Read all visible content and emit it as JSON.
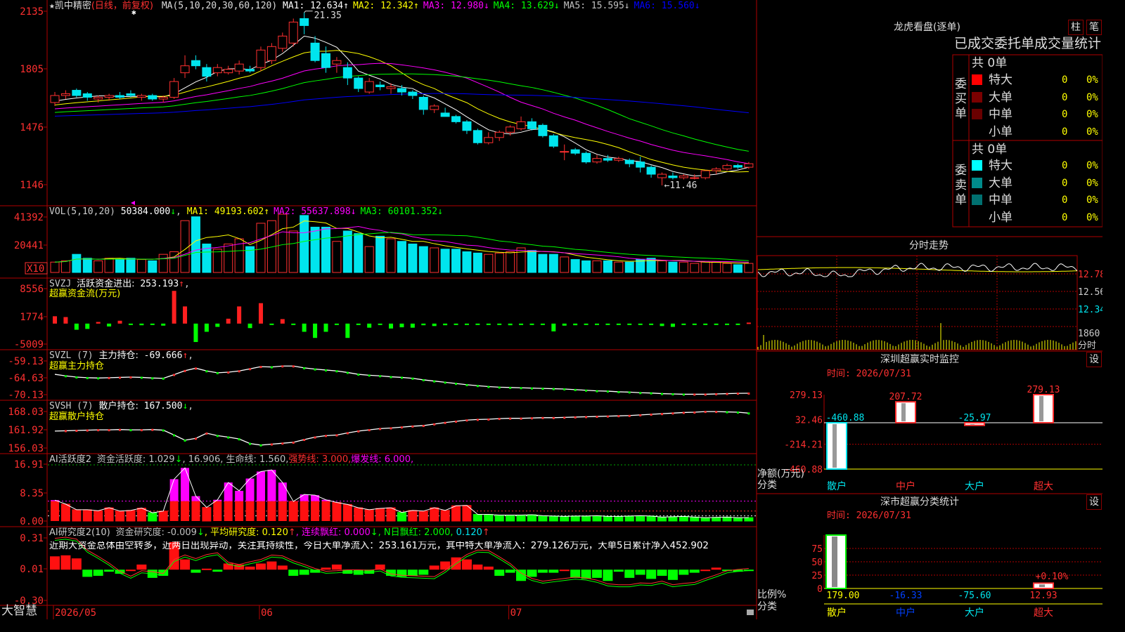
{
  "stock": {
    "name_prefix": "★",
    "name": "凯中精密",
    "period": "(日线，前复权)",
    "star_marker": "✱",
    "logo": "大智慧"
  },
  "colors": {
    "up": "#ff3030",
    "down": "#00e5ee",
    "bg": "#000000",
    "grid": "#8b0000",
    "text": "#c0c0c0",
    "ma1": "#ffffff",
    "ma2": "#ffff00",
    "ma3": "#ff00ff",
    "ma4": "#00ff00",
    "ma5": "#c0c0c0",
    "ma6": "#0000ff",
    "green": "#00ff00",
    "yellow": "#ffff00",
    "magenta": "#ff00ff",
    "cyan": "#00ffff"
  },
  "x_axis": {
    "labels": [
      {
        "text": "2026/05",
        "i": 0
      },
      {
        "text": "06",
        "i": 19
      },
      {
        "text": "07",
        "i": 42
      }
    ]
  },
  "price_panel": {
    "label": "MA(5,10,20,30,60,120)",
    "ma": [
      {
        "name": "MA1:",
        "value": "12.634",
        "arrow": "↑",
        "color": "#ffffff"
      },
      {
        "name": "MA2:",
        "value": "12.342",
        "arrow": "↑",
        "color": "#ffff00"
      },
      {
        "name": "MA3:",
        "value": "12.980",
        "arrow": "↓",
        "color": "#ff00ff"
      },
      {
        "name": "MA4:",
        "value": "13.629",
        "arrow": "↓",
        "color": "#00ff00"
      },
      {
        "name": "MA5:",
        "value": "15.595",
        "arrow": "↓",
        "color": "#c0c0c0"
      },
      {
        "name": "MA6:",
        "value": "15.560",
        "arrow": "↓",
        "color": "#0000ff"
      }
    ],
    "y_labels": [
      "2135",
      "1805",
      "1476",
      "1146"
    ],
    "high_label": "21.35",
    "low_label": "←11.46"
  },
  "vol_panel": {
    "label": "VOL(5,10,20)",
    "value": "50384.000",
    "arrow": "↓",
    "ma": [
      {
        "name": "MA1:",
        "value": "49193.602",
        "arrow": "↑",
        "color": "#ffff00"
      },
      {
        "name": "MA2:",
        "value": "55637.898",
        "arrow": "↓",
        "color": "#ff00ff"
      },
      {
        "name": "MA3:",
        "value": "60101.352",
        "arrow": "↓",
        "color": "#00ff00"
      }
    ],
    "y_labels": [
      "41392",
      "20441"
    ],
    "unit": "X10"
  },
  "svzj_panel": {
    "label": "SVZJ",
    "name": "活跃资金进出:",
    "value": "253.193",
    "arrow": "↑",
    "subtitle": "超赢资金流(万元)",
    "y_labels": [
      "8556",
      "1774",
      "-5009"
    ]
  },
  "svzl_panel": {
    "label": "SVZL (7)",
    "name": "主力持仓:",
    "value": "-69.666",
    "arrow": "↑",
    "subtitle": "超赢主力持仓",
    "y_labels": [
      "-59.13",
      "-64.63",
      "-70.13"
    ]
  },
  "svsh_panel": {
    "label": "SVSH (7)",
    "name": "散户持仓:",
    "value": "167.500",
    "arrow": "↓",
    "subtitle": "超赢散户持仓",
    "y_labels": [
      "168.03",
      "161.92",
      "156.03"
    ]
  },
  "ai1_panel": {
    "label": "AI活跃度2",
    "items": [
      {
        "text": "资金活跃度: 1.029",
        "color": "#c0c0c0"
      },
      {
        "text": "↓",
        "color": "#00ff00"
      },
      {
        "text": ", 16.906, 生命线: 1.560,",
        "color": "#c0c0c0"
      },
      {
        "text": "强势线: 3.000,",
        "color": "#ff3030"
      },
      {
        "text": "爆发线: 6.000,",
        "color": "#ff00ff"
      }
    ],
    "y_labels": [
      "16.91",
      "8.35",
      "0.00"
    ]
  },
  "ai2_panel": {
    "label": "AI研究度2(10)",
    "items": [
      {
        "text": "资金研究度: -0.009",
        "color": "#c0c0c0"
      },
      {
        "text": "↓",
        "color": "#00ff00"
      },
      {
        "text": ", 平均研究度: 0.120",
        "color": "#ffff00"
      },
      {
        "text": "↑",
        "color": "#ff3030"
      },
      {
        "text": ", 连续飘红: 0.000",
        "color": "#ff00ff"
      },
      {
        "text": "↓",
        "color": "#00ff00"
      },
      {
        "text": ", N日飘红: 2.000, ",
        "color": "#00ff00"
      },
      {
        "text": "0.120",
        "color": "#00e5ee"
      },
      {
        "text": "↑",
        "color": "#ff3030"
      }
    ],
    "comment": "近期大资金总体由空转多，近两日出现异动，关注其持续性，今日大单净流入：253.161万元，其中特大单净流入：279.126万元，大单5日累计净入452.902",
    "y_labels": [
      "0.31",
      "0.01",
      "-0.30"
    ]
  },
  "dragon_tiger": {
    "title": "龙虎看盘(逐单)",
    "btn1": "柱",
    "btn2": "笔",
    "header": "已成交委托单成交量统计",
    "buy": {
      "side": "委买单",
      "total": "共 0单",
      "rows": [
        {
          "label": "特大",
          "count": "0",
          "pct": "0%",
          "color": "#ff0000"
        },
        {
          "label": "大单",
          "count": "0",
          "pct": "0%",
          "color": "#7a0000"
        },
        {
          "label": "中单",
          "count": "0",
          "pct": "0%",
          "color": "#6a0000"
        },
        {
          "label": "小单",
          "count": "0",
          "pct": "0%",
          "color": "#000000"
        }
      ]
    },
    "sell": {
      "side": "委卖单",
      "total": "共 0单",
      "rows": [
        {
          "label": "特大",
          "count": "0",
          "pct": "0%",
          "color": "#00ffff"
        },
        {
          "label": "大单",
          "count": "0",
          "pct": "0%",
          "color": "#008b8b"
        },
        {
          "label": "中单",
          "count": "0",
          "pct": "0%",
          "color": "#007070"
        },
        {
          "label": "小单",
          "count": "0",
          "pct": "0%",
          "color": "#000000"
        }
      ]
    }
  },
  "intraday": {
    "title": "分时走势",
    "y_labels": [
      "12.78",
      "12.56",
      "12.34"
    ],
    "vol_label": "1860",
    "vol_unit": "分时"
  },
  "monitor": {
    "title": "深圳超赢实时监控",
    "btn": "设",
    "date": "时间: 2026/07/31",
    "y_labels": [
      "279.13",
      "32.46",
      "-214.21",
      "-460.88"
    ],
    "axis_title": "净额(万元)",
    "axis_sub": "分类",
    "categories": [
      "散户",
      "中户",
      "大户",
      "超大"
    ],
    "values": [
      -460.88,
      207.72,
      -25.97,
      279.13
    ],
    "value_labels": [
      "-460.88",
      "207.72",
      "-25.97",
      "279.13"
    ]
  },
  "classify": {
    "title": "深市超赢分类统计",
    "btn": "设",
    "date": "时间: 2026/07/31",
    "y_labels": [
      "75",
      "50",
      "25",
      "0"
    ],
    "axis_title": "比例%",
    "axis_sub": "分类",
    "categories": [
      "散户",
      "中户",
      "大户",
      "超大"
    ],
    "values": [
      179.0,
      -16.33,
      -75.6,
      12.93
    ],
    "value_labels": [
      "179.00",
      "-16.33",
      "-75.60",
      "12.93"
    ],
    "extra_label": "+0.10%"
  },
  "chart_data": [
    {
      "type": "candlestick",
      "title": "凯中精密 (日线，前复权)",
      "ylim": [
        11.3,
        21.5
      ],
      "ohlc": [
        [
          16.2,
          16.8,
          16.0,
          16.6
        ],
        [
          16.6,
          16.9,
          16.4,
          16.7
        ],
        [
          16.9,
          17.0,
          16.5,
          16.6
        ],
        [
          16.7,
          16.8,
          16.3,
          16.5
        ],
        [
          16.4,
          16.6,
          16.2,
          16.5
        ],
        [
          16.5,
          16.7,
          16.3,
          16.6
        ],
        [
          16.6,
          16.8,
          16.4,
          16.5
        ],
        [
          16.7,
          16.9,
          16.5,
          16.6
        ],
        [
          16.5,
          16.7,
          16.3,
          16.6
        ],
        [
          16.6,
          16.7,
          16.3,
          16.4
        ],
        [
          16.4,
          16.6,
          16.2,
          16.5
        ],
        [
          16.5,
          17.6,
          16.4,
          17.4
        ],
        [
          17.9,
          18.9,
          17.6,
          18.3
        ],
        [
          18.6,
          18.9,
          18.1,
          18.3
        ],
        [
          18.2,
          18.4,
          17.4,
          17.7
        ],
        [
          17.9,
          18.4,
          17.7,
          18.2
        ],
        [
          17.9,
          18.3,
          17.8,
          18.1
        ],
        [
          18.0,
          18.6,
          17.8,
          18.4
        ],
        [
          18.1,
          18.3,
          17.9,
          18.0
        ],
        [
          18.2,
          19.4,
          18.0,
          19.2
        ],
        [
          18.6,
          19.6,
          18.4,
          19.4
        ],
        [
          19.3,
          20.2,
          19.1,
          20.0
        ],
        [
          19.6,
          21.0,
          19.4,
          20.8
        ],
        [
          21.0,
          21.35,
          20.1,
          20.6
        ],
        [
          19.6,
          20.0,
          18.5,
          18.6
        ],
        [
          19.0,
          19.4,
          17.9,
          18.2
        ],
        [
          18.4,
          18.8,
          17.9,
          18.6
        ],
        [
          18.2,
          18.5,
          17.2,
          17.6
        ],
        [
          17.6,
          17.7,
          16.8,
          17.0
        ],
        [
          16.8,
          17.6,
          16.7,
          17.4
        ],
        [
          17.2,
          17.4,
          16.9,
          17.1
        ],
        [
          17.0,
          17.3,
          16.7,
          17.1
        ],
        [
          17.0,
          17.2,
          16.6,
          16.8
        ],
        [
          16.8,
          16.9,
          16.4,
          16.6
        ],
        [
          16.5,
          16.6,
          15.5,
          15.8
        ],
        [
          15.8,
          16.1,
          15.6,
          16.0
        ],
        [
          15.6,
          15.9,
          15.4,
          15.4
        ],
        [
          15.4,
          15.5,
          15.0,
          15.1
        ],
        [
          15.1,
          15.2,
          14.4,
          14.6
        ],
        [
          14.6,
          14.7,
          13.8,
          13.9
        ],
        [
          13.9,
          14.5,
          13.8,
          14.2
        ],
        [
          14.2,
          14.6,
          14.0,
          14.5
        ],
        [
          14.5,
          14.9,
          14.3,
          14.8
        ],
        [
          14.7,
          15.4,
          14.6,
          15.1
        ],
        [
          15.1,
          15.3,
          14.6,
          14.7
        ],
        [
          14.9,
          15.0,
          14.2,
          14.3
        ],
        [
          14.3,
          14.4,
          13.6,
          13.7
        ],
        [
          13.4,
          13.8,
          12.9,
          13.4
        ],
        [
          13.5,
          13.6,
          13.2,
          13.3
        ],
        [
          13.3,
          13.4,
          12.7,
          12.8
        ],
        [
          12.8,
          13.2,
          12.7,
          13.0
        ],
        [
          13.0,
          13.2,
          12.8,
          12.9
        ],
        [
          12.9,
          13.1,
          12.8,
          13.0
        ],
        [
          12.9,
          13.0,
          12.5,
          12.7
        ],
        [
          12.8,
          13.1,
          12.2,
          12.5
        ],
        [
          12.5,
          12.6,
          11.9,
          12.1
        ],
        [
          11.9,
          12.2,
          11.46,
          12.1
        ],
        [
          12.0,
          12.2,
          11.8,
          11.9
        ],
        [
          11.9,
          12.1,
          11.8,
          12.0
        ],
        [
          11.9,
          12.1,
          11.8,
          11.9
        ],
        [
          11.9,
          12.3,
          11.8,
          12.3
        ],
        [
          12.3,
          12.5,
          12.1,
          12.4
        ],
        [
          12.4,
          12.7,
          12.3,
          12.6
        ],
        [
          12.6,
          12.7,
          12.4,
          12.5
        ],
        [
          12.5,
          12.8,
          12.4,
          12.7
        ]
      ]
    },
    {
      "type": "bar",
      "title": "VOL(5,10,20)",
      "unit": "X10",
      "values": [
        8,
        9,
        14,
        11,
        9,
        11,
        10,
        11,
        10,
        9,
        14,
        16,
        40,
        43,
        22,
        18,
        22,
        26,
        20,
        38,
        40,
        45,
        32,
        44,
        35,
        35,
        24,
        32,
        30,
        20,
        28,
        26,
        24,
        22,
        20,
        19,
        18,
        18,
        16,
        15,
        14,
        15,
        16,
        19,
        17,
        14,
        14,
        12,
        10,
        9,
        9,
        9,
        8,
        8,
        10,
        11,
        9,
        8,
        8,
        7,
        8,
        8,
        7,
        6,
        7
      ]
    },
    {
      "type": "bar",
      "title": "SVZJ 活跃资金进出 (万元)",
      "ylim": [
        -5009,
        8556
      ],
      "values": [
        1800,
        1600,
        -1500,
        -1300,
        400,
        -700,
        700,
        -300,
        -400,
        -200,
        -500,
        8000,
        4200,
        -4500,
        -2000,
        -800,
        1200,
        4200,
        -1100,
        5000,
        -200,
        1100,
        -200,
        -2000,
        -3500,
        -2000,
        -200,
        -3500,
        -200,
        -1000,
        -300,
        -1200,
        -900,
        -1000,
        -400,
        -600,
        -400,
        -300,
        -300,
        -200,
        -300,
        -200,
        -400,
        -200,
        -300,
        -300,
        -1900,
        -500,
        -400,
        -300,
        -200,
        -200,
        -300,
        -200,
        -300,
        -200,
        -600,
        -800,
        -200,
        -200,
        -200,
        -200,
        -200,
        -200,
        253
      ]
    },
    {
      "type": "line",
      "title": "SVZL 主力持仓",
      "ylim": [
        -70.13,
        -59.13
      ],
      "values": [
        -63.5,
        -64.0,
        -64.4,
        -64.6,
        -64.7,
        -64.6,
        -64.5,
        -64.4,
        -64.5,
        -64.7,
        -64.8,
        -63.6,
        -62.3,
        -61.5,
        -62.4,
        -63.0,
        -62.8,
        -62.4,
        -61.7,
        -61.0,
        -61.1,
        -60.8,
        -60.8,
        -61.4,
        -61.8,
        -62.1,
        -62.4,
        -62.9,
        -63.5,
        -63.8,
        -64.0,
        -64.3,
        -64.5,
        -64.8,
        -65.3,
        -65.7,
        -66.1,
        -66.5,
        -66.9,
        -67.2,
        -67.5,
        -67.7,
        -67.8,
        -67.9,
        -68.0,
        -68.1,
        -68.2,
        -68.3,
        -68.5,
        -68.7,
        -68.9,
        -69.0,
        -69.2,
        -69.3,
        -69.5,
        -69.6,
        -69.8,
        -69.9,
        -70.0,
        -70.0,
        -70.0,
        -69.9,
        -69.8,
        -69.7,
        -69.666
      ]
    },
    {
      "type": "line",
      "title": "SVSH 散户持仓",
      "ylim": [
        156.03,
        168.03
      ],
      "values": [
        161.6,
        161.7,
        161.8,
        161.9,
        162.0,
        162.0,
        162.1,
        162.0,
        162.0,
        162.1,
        161.9,
        160.3,
        158.6,
        159.2,
        160.9,
        160.1,
        159.6,
        159.0,
        157.5,
        157.0,
        157.3,
        157.6,
        157.9,
        158.8,
        159.6,
        160.1,
        160.3,
        161.0,
        161.6,
        162.0,
        162.4,
        162.6,
        162.9,
        163.2,
        163.4,
        163.9,
        164.4,
        164.8,
        165.2,
        165.4,
        165.5,
        165.7,
        165.8,
        165.8,
        165.9,
        166.0,
        166.0,
        166.1,
        166.2,
        166.3,
        166.4,
        166.5,
        166.6,
        166.7,
        166.9,
        167.1,
        167.3,
        167.5,
        167.7,
        167.8,
        168.0,
        168.0,
        167.9,
        167.8,
        167.5
      ]
    },
    {
      "type": "bar",
      "title": "AI活跃度2 资金活跃度",
      "ylim": [
        0,
        16.91
      ],
      "values": [
        6.3,
        5.1,
        3.4,
        3.4,
        3.1,
        4.0,
        3.0,
        3.2,
        3.9,
        2.5,
        3.0,
        12.6,
        16.0,
        7.5,
        4.1,
        6.4,
        11.6,
        9.1,
        12.8,
        14.9,
        15.4,
        11.6,
        5.9,
        8.0,
        7.8,
        6.4,
        5.6,
        5.0,
        4.0,
        3.4,
        3.8,
        4.0,
        2.6,
        3.2,
        3.0,
        4.0,
        3.2,
        4.6,
        4.7,
        2.0,
        2.0,
        1.8,
        1.8,
        1.8,
        1.9,
        1.6,
        1.5,
        1.4,
        1.5,
        1.5,
        1.6,
        1.4,
        1.4,
        1.5,
        1.6,
        1.5,
        1.2,
        1.3,
        1.4,
        1.2,
        1.0,
        1.1,
        1.2,
        1.0,
        1.029
      ]
    },
    {
      "type": "bar",
      "title": "AI研究度2(10) 资金研究度",
      "ylim": [
        -0.3,
        0.31
      ],
      "values": [
        0.13,
        0.14,
        0.11,
        -0.07,
        -0.06,
        -0.02,
        -0.04,
        0.0,
        0.05,
        -0.08,
        -0.06,
        0.27,
        0.1,
        -0.03,
        0.01,
        -0.02,
        0.06,
        0.05,
        0.03,
        0.06,
        0.08,
        0.04,
        -0.06,
        -0.05,
        -0.03,
        0.02,
        0.05,
        -0.04,
        -0.05,
        -0.04,
        0.05,
        -0.06,
        -0.07,
        -0.06,
        -0.05,
        0.04,
        0.08,
        0.12,
        0.1,
        0.05,
        0.03,
        -0.06,
        -0.03,
        -0.11,
        -0.07,
        -0.03,
        -0.03,
        0.0,
        -0.08,
        -0.09,
        -0.08,
        -0.11,
        -0.02,
        -0.08,
        -0.05,
        -0.09,
        -0.06,
        -0.1,
        -0.05,
        -0.03,
        0.0,
        0.02,
        -0.01,
        -0.02,
        -0.009
      ]
    }
  ]
}
